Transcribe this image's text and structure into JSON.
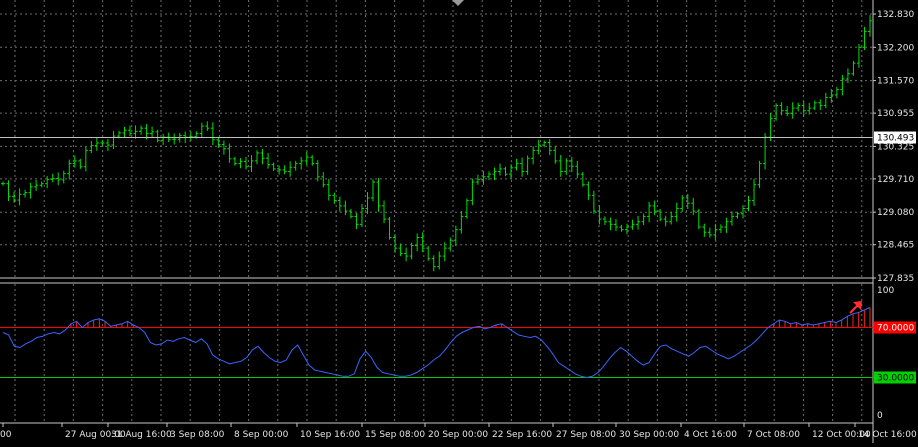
{
  "chart_data": [
    {
      "type": "bar",
      "subtype": "ohlc-price",
      "y_ticks": [
        "132.830",
        "132.200",
        "131.570",
        "130.955",
        "130.325",
        "129.710",
        "129.080",
        "128.465",
        "127.835"
      ],
      "ylim": [
        127.835,
        132.83
      ],
      "current_price": "130.493",
      "current_price_value": 130.493,
      "grid": true,
      "colors": {
        "bars": "#00e000",
        "grid": "#6e6e6e",
        "price_line": "#c0c0c0",
        "label_bg": "#ffffff"
      },
      "x_count": 180,
      "series": [
        {
          "values": [
            129.62,
            129.38,
            129.31,
            129.42,
            129.45,
            129.56,
            129.59,
            129.62,
            129.7,
            129.72,
            129.69,
            129.81,
            130.0,
            130.05,
            129.94,
            130.25,
            130.34,
            130.39,
            130.39,
            130.35,
            130.52,
            130.58,
            130.63,
            130.57,
            130.61,
            130.67,
            130.57,
            130.6,
            130.44,
            130.5,
            130.46,
            130.46,
            130.53,
            130.5,
            130.51,
            130.57,
            130.71,
            130.67,
            130.45,
            130.36,
            130.28,
            130.09,
            130.0,
            130.04,
            129.94,
            130.05,
            130.2,
            130.1,
            129.98,
            129.9,
            129.88,
            129.85,
            129.93,
            130.0,
            130.05,
            130.12,
            130.0,
            129.75,
            129.6,
            129.4,
            129.3,
            129.2,
            129.1,
            129.0,
            128.85,
            129.15,
            129.35,
            129.65,
            129.2,
            128.95,
            128.6,
            128.4,
            128.3,
            128.25,
            128.45,
            128.6,
            128.4,
            128.2,
            128.05,
            128.25,
            128.4,
            128.55,
            128.75,
            129.0,
            129.3,
            129.65,
            129.7,
            129.75,
            129.8,
            129.85,
            129.9,
            129.8,
            129.92,
            130.0,
            129.85,
            130.1,
            130.25,
            130.35,
            130.4,
            130.25,
            130.05,
            129.85,
            130.05,
            129.95,
            129.8,
            129.6,
            129.4,
            129.1,
            128.95,
            128.9,
            128.85,
            128.8,
            128.75,
            128.8,
            128.85,
            128.9,
            129.0,
            129.2,
            129.1,
            128.95,
            128.9,
            129.0,
            129.15,
            129.35,
            129.25,
            129.1,
            128.8,
            128.7,
            128.65,
            128.75,
            128.8,
            128.9,
            129.0,
            129.05,
            129.15,
            129.3,
            129.6,
            130.0,
            130.5,
            130.85,
            131.1,
            131.0,
            130.95,
            131.05,
            131.1,
            131.0,
            131.05,
            131.15,
            131.1,
            131.25,
            131.3,
            131.4,
            131.6,
            131.7,
            131.9,
            132.2,
            132.5,
            132.7
          ]
        }
      ]
    },
    {
      "type": "line",
      "subtype": "oscillator",
      "y_ticks": [
        "100",
        "70.0000",
        "30.0000",
        "0"
      ],
      "ylim": [
        0,
        100
      ],
      "levels": [
        {
          "label": "70.0000",
          "value": 70,
          "color": "#ff0000"
        },
        {
          "label": "30.0000",
          "value": 30,
          "color": "#00d000"
        }
      ],
      "colors": {
        "line": "#3a64ff",
        "overbought_fill": "#ff2020",
        "arrow": "#ff3030"
      },
      "x_labels": [
        "00",
        "27 Aug 00:00",
        "31 Aug 16:00",
        "3 Sep 08:00",
        "8 Sep 00:00",
        "10 Sep 16:00",
        "15 Sep 08:00",
        "20 Sep 00:00",
        "22 Sep 16:00",
        "27 Sep 08:00",
        "30 Sep 00:00",
        "4 Oct 16:00",
        "7 Oct 08:00",
        "12 Oct 00:00",
        "14 Oct 16:00"
      ],
      "series": [
        {
          "values": [
            66,
            64,
            55,
            54,
            57,
            59,
            62,
            63,
            65,
            66,
            65,
            68,
            73,
            75,
            70,
            74,
            76,
            77,
            75,
            71,
            72,
            73,
            75,
            72,
            70,
            66,
            58,
            56,
            57,
            60,
            59,
            61,
            62,
            60,
            58,
            61,
            57,
            48,
            45,
            43,
            41,
            42,
            43,
            46,
            52,
            55,
            50,
            46,
            43,
            42,
            44,
            52,
            56,
            48,
            40,
            36,
            35,
            34,
            33,
            32,
            31,
            31,
            33,
            45,
            51,
            46,
            38,
            34,
            33,
            32,
            31,
            31,
            32,
            34,
            37,
            40,
            44,
            47,
            52,
            58,
            63,
            66,
            68,
            70,
            71,
            69,
            70,
            72,
            73,
            70,
            67,
            64,
            63,
            62,
            63,
            60,
            55,
            49,
            42,
            39,
            36,
            33,
            31,
            30,
            31,
            34,
            39,
            45,
            50,
            54,
            51,
            47,
            43,
            40,
            42,
            49,
            55,
            56,
            53,
            51,
            49,
            47,
            50,
            54,
            55,
            52,
            49,
            47,
            45,
            47,
            50,
            53,
            56,
            60,
            65,
            70,
            73,
            76,
            75,
            73,
            74,
            72,
            73,
            72,
            73,
            74,
            75,
            74,
            76,
            79,
            81,
            82,
            84,
            86
          ]
        }
      ]
    }
  ]
}
